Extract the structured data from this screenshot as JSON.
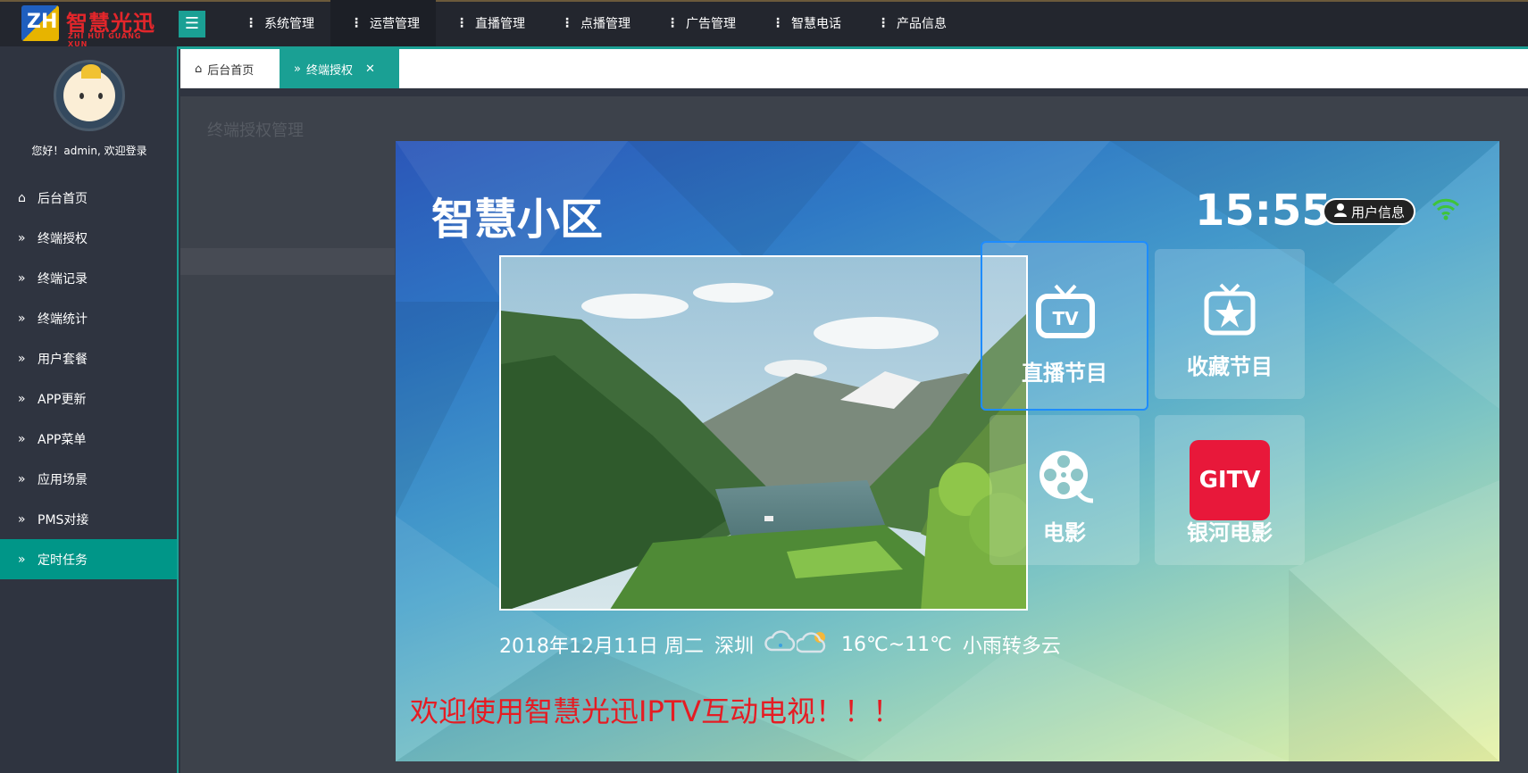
{
  "brand": {
    "cn": "智慧光迅",
    "en": "ZHI HUI GUANG XUN",
    "mark": "ZH"
  },
  "top_nav": [
    {
      "label": "系统管理",
      "active": false
    },
    {
      "label": "运营管理",
      "active": true
    },
    {
      "label": "直播管理",
      "active": false
    },
    {
      "label": "点播管理",
      "active": false
    },
    {
      "label": "广告管理",
      "active": false
    },
    {
      "label": "智慧电话",
      "active": false
    },
    {
      "label": "产品信息",
      "active": false
    }
  ],
  "sidebar": {
    "welcome": "您好！admin, 欢迎登录",
    "items": [
      {
        "label": "后台首页",
        "icon": "home-icon"
      },
      {
        "label": "终端授权",
        "icon": "double-chevron-icon"
      },
      {
        "label": "终端记录",
        "icon": "double-chevron-icon"
      },
      {
        "label": "终端统计",
        "icon": "double-chevron-icon"
      },
      {
        "label": "用户套餐",
        "icon": "double-chevron-icon"
      },
      {
        "label": "APP更新",
        "icon": "double-chevron-icon"
      },
      {
        "label": "APP菜单",
        "icon": "double-chevron-icon"
      },
      {
        "label": "应用场景",
        "icon": "double-chevron-icon"
      },
      {
        "label": "PMS对接",
        "icon": "double-chevron-icon"
      },
      {
        "label": "定时任务",
        "icon": "double-chevron-icon",
        "active": true
      }
    ]
  },
  "tabs": {
    "home": "后台首页",
    "current": "终端授权"
  },
  "background_page": {
    "title": "终端授权管理"
  },
  "tv_preview": {
    "title": "智慧小区",
    "time": "15:55",
    "user_info": "用户信息",
    "tiles": {
      "live": "直播节目",
      "favorite": "收藏节目",
      "movie": "电影",
      "galaxy": "银河电影",
      "gitv_logo": "GITV"
    },
    "date": "2018年12月11日 周二",
    "city": "深圳",
    "temperature": "16℃~11℃",
    "weather": "小雨转多云",
    "marquee": "欢迎使用智慧光迅IPTV互动电视！！！"
  },
  "colors": {
    "accent": "#1aa094",
    "sidebar_bg": "#2f3440",
    "topbar_bg": "#23262e",
    "marquee": "#e51c23",
    "gitv": "#e8183a"
  }
}
